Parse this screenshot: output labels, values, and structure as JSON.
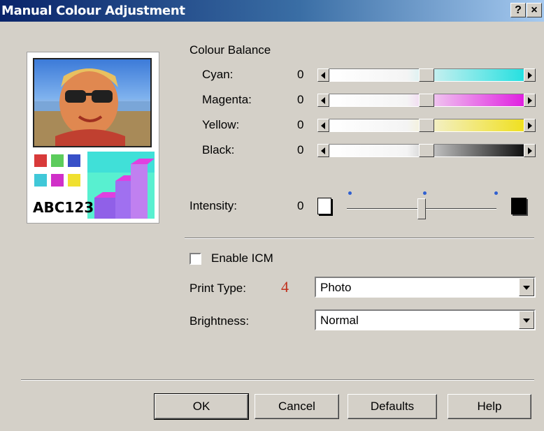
{
  "window": {
    "title": "Manual Colour Adjustment",
    "help_glyph": "?",
    "close_glyph": "×"
  },
  "preview": {
    "text": "ABC123",
    "swatches": [
      "#d83a3a",
      "#5ccc5c",
      "#3850c8",
      "#40c8d8",
      "#d030c8",
      "#f0e030"
    ]
  },
  "colour_balance": {
    "heading": "Colour Balance",
    "sliders": [
      {
        "label": "Cyan:",
        "value": "0",
        "color": "#26e0e0",
        "level": 0.5
      },
      {
        "label": "Magenta:",
        "value": "0",
        "color": "#e020e0",
        "level": 0.5
      },
      {
        "label": "Yellow:",
        "value": "0",
        "color": "#f0e020",
        "level": 0.5
      },
      {
        "label": "Black:",
        "value": "0",
        "color": "#101010",
        "level": 0.5
      }
    ]
  },
  "intensity": {
    "label": "Intensity:",
    "value": "0",
    "level": 0.5
  },
  "icm": {
    "label": "Enable ICM",
    "checked": false
  },
  "print_type": {
    "label": "Print Type:",
    "marker": "4",
    "marker_color": "#c0301c",
    "selected": "Photo"
  },
  "brightness": {
    "label": "Brightness:",
    "selected": "Normal"
  },
  "buttons": {
    "ok": "OK",
    "cancel": "Cancel",
    "defaults": "Defaults",
    "help": "Help"
  }
}
